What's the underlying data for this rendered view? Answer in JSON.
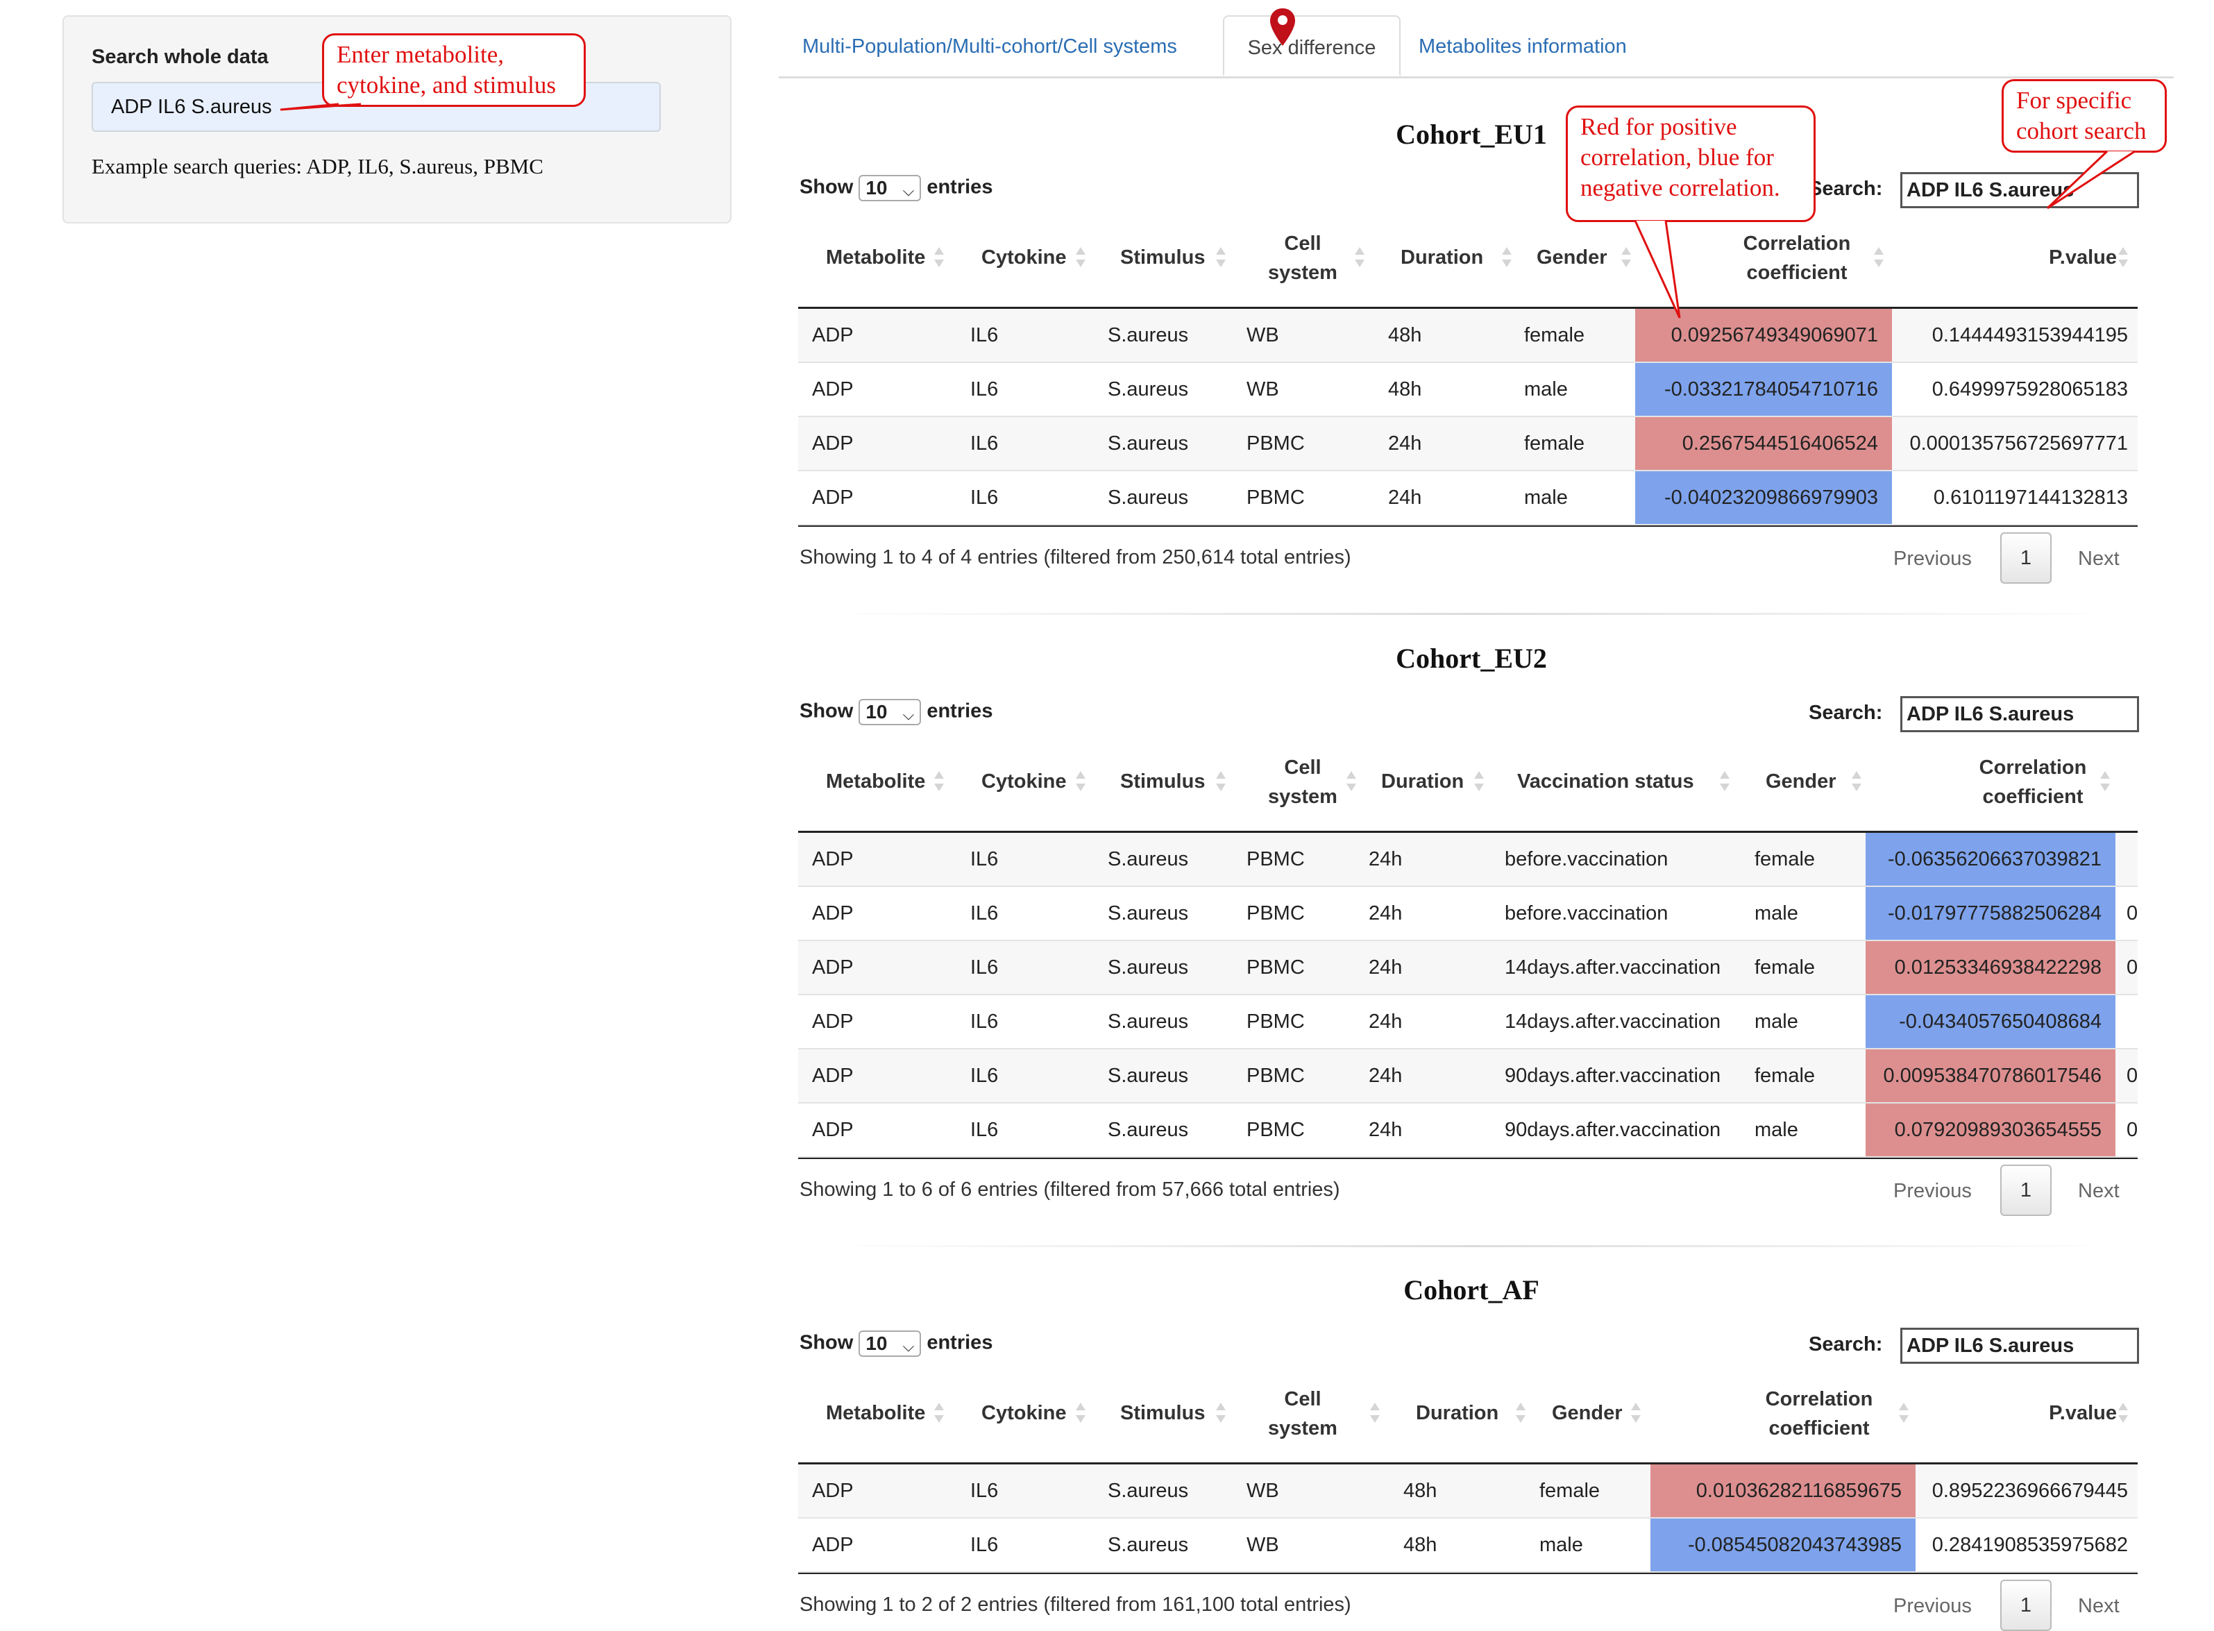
{
  "sidebar": {
    "label": "Search whole data",
    "input_value": "ADP IL6 S.aureus",
    "example": "Example search queries: ADP, IL6, S.aureus, PBMC"
  },
  "tabs": [
    {
      "label": "Multi-Population/Multi-cohort/Cell systems",
      "active": false
    },
    {
      "label": "Sex difference",
      "active": true
    },
    {
      "label": "Metabolites information",
      "active": false
    }
  ],
  "annotations": {
    "input_hint": "Enter metabolite, cytokine, and stimulus",
    "color_hint": "Red for positive correlation, blue for negative correlation.",
    "search_hint": "For specific cohort search"
  },
  "colors": {
    "positive": "#dd8f8f",
    "negative": "#7ea3ec",
    "link": "#2a6db3",
    "annotation": "#e01010"
  },
  "common": {
    "show": "Show",
    "entries": "entries",
    "page_size": "10",
    "search_label": "Search:",
    "previous": "Previous",
    "next": "Next",
    "page": "1"
  },
  "cohorts": [
    {
      "title": "Cohort_EU1",
      "search_value": "ADP IL6 S.aureus",
      "headers": [
        "Metabolite",
        "Cytokine",
        "Stimulus",
        "Cell system",
        "Duration",
        "Gender",
        "Correlation coefficient",
        "P.value"
      ],
      "rows": [
        {
          "metabolite": "ADP",
          "cytokine": "IL6",
          "stimulus": "S.aureus",
          "cell": "WB",
          "duration": "48h",
          "gender": "female",
          "corr": "0.09256749349069071",
          "sign": "positive",
          "pval": "0.1444493153944195"
        },
        {
          "metabolite": "ADP",
          "cytokine": "IL6",
          "stimulus": "S.aureus",
          "cell": "WB",
          "duration": "48h",
          "gender": "male",
          "corr": "-0.03321784054710716",
          "sign": "negative",
          "pval": "0.6499975928065183"
        },
        {
          "metabolite": "ADP",
          "cytokine": "IL6",
          "stimulus": "S.aureus",
          "cell": "PBMC",
          "duration": "24h",
          "gender": "female",
          "corr": "0.2567544516406524",
          "sign": "positive",
          "pval": "0.000135756725697771"
        },
        {
          "metabolite": "ADP",
          "cytokine": "IL6",
          "stimulus": "S.aureus",
          "cell": "PBMC",
          "duration": "24h",
          "gender": "male",
          "corr": "-0.04023209866979903",
          "sign": "negative",
          "pval": "0.6101197144132813"
        }
      ],
      "info": "Showing 1 to 4 of 4 entries (filtered from 250,614 total entries)"
    },
    {
      "title": "Cohort_EU2",
      "search_value": "ADP IL6 S.aureus",
      "headers": [
        "Metabolite",
        "Cytokine",
        "Stimulus",
        "Cell system",
        "Duration",
        "Vaccination status",
        "Gender",
        "Correlation coefficient"
      ],
      "rows": [
        {
          "metabolite": "ADP",
          "cytokine": "IL6",
          "stimulus": "S.aureus",
          "cell": "PBMC",
          "duration": "24h",
          "vacc": "before.vaccination",
          "gender": "female",
          "corr": "-0.06356206637039821",
          "sign": "negative",
          "pval": ""
        },
        {
          "metabolite": "ADP",
          "cytokine": "IL6",
          "stimulus": "S.aureus",
          "cell": "PBMC",
          "duration": "24h",
          "vacc": "before.vaccination",
          "gender": "male",
          "corr": "-0.01797775882506284",
          "sign": "negative",
          "pval": "0"
        },
        {
          "metabolite": "ADP",
          "cytokine": "IL6",
          "stimulus": "S.aureus",
          "cell": "PBMC",
          "duration": "24h",
          "vacc": "14days.after.vaccination",
          "gender": "female",
          "corr": "0.01253346938422298",
          "sign": "positive",
          "pval": "0"
        },
        {
          "metabolite": "ADP",
          "cytokine": "IL6",
          "stimulus": "S.aureus",
          "cell": "PBMC",
          "duration": "24h",
          "vacc": "14days.after.vaccination",
          "gender": "male",
          "corr": "-0.0434057650408684",
          "sign": "negative",
          "pval": ""
        },
        {
          "metabolite": "ADP",
          "cytokine": "IL6",
          "stimulus": "S.aureus",
          "cell": "PBMC",
          "duration": "24h",
          "vacc": "90days.after.vaccination",
          "gender": "female",
          "corr": "0.009538470786017546",
          "sign": "positive",
          "pval": "0"
        },
        {
          "metabolite": "ADP",
          "cytokine": "IL6",
          "stimulus": "S.aureus",
          "cell": "PBMC",
          "duration": "24h",
          "vacc": "90days.after.vaccination",
          "gender": "male",
          "corr": "0.07920989303654555",
          "sign": "positive",
          "pval": "0"
        }
      ],
      "info": "Showing 1 to 6 of 6 entries (filtered from 57,666 total entries)"
    },
    {
      "title": "Cohort_AF",
      "search_value": "ADP IL6 S.aureus",
      "headers": [
        "Metabolite",
        "Cytokine",
        "Stimulus",
        "Cell system",
        "Duration",
        "Gender",
        "Correlation coefficient",
        "P.value"
      ],
      "rows": [
        {
          "metabolite": "ADP",
          "cytokine": "IL6",
          "stimulus": "S.aureus",
          "cell": "WB",
          "duration": "48h",
          "gender": "female",
          "corr": "0.01036282116859675",
          "sign": "positive",
          "pval": "0.8952236966679445"
        },
        {
          "metabolite": "ADP",
          "cytokine": "IL6",
          "stimulus": "S.aureus",
          "cell": "WB",
          "duration": "48h",
          "gender": "male",
          "corr": "-0.08545082043743985",
          "sign": "negative",
          "pval": "0.2841908535975682"
        }
      ],
      "info": "Showing 1 to 2 of 2 entries (filtered from 161,100 total entries)"
    }
  ]
}
